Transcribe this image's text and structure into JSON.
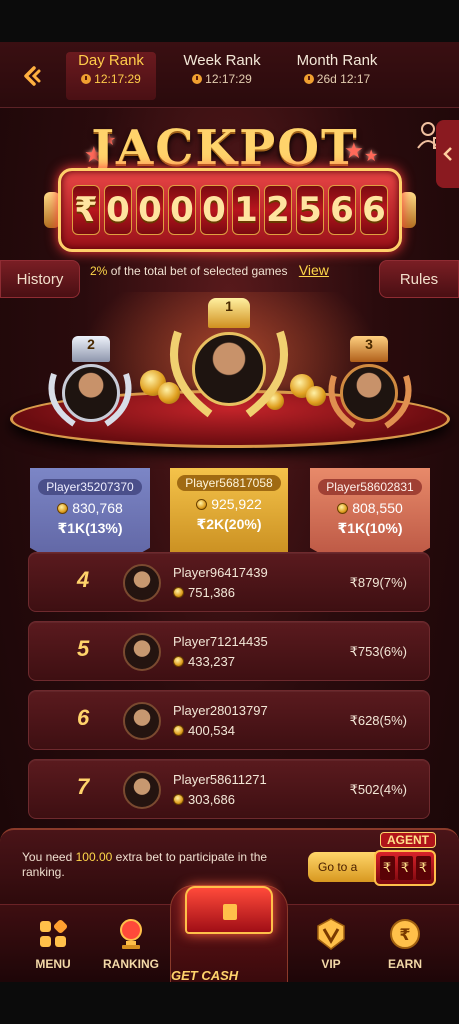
{
  "header": {
    "tabs": [
      {
        "label": "Day Rank",
        "time": "12:17:29",
        "active": true
      },
      {
        "label": "Week Rank",
        "time": "12:17:29",
        "active": false
      },
      {
        "label": "Month Rank",
        "time": "26d 12:17",
        "active": false
      }
    ]
  },
  "jackpot": {
    "title": "JACKPOT",
    "currency": "₹",
    "digits": [
      "0",
      "0",
      "0",
      "0",
      "1",
      "2",
      "5",
      "6",
      "6"
    ]
  },
  "actions": {
    "history_label": "History",
    "rules_label": "Rules",
    "info_pct": "2%",
    "info_text": "of the total bet of selected games",
    "view_label": "View"
  },
  "podium": [
    {
      "rank": "2",
      "name": "Player35207370",
      "score": "830,768",
      "reward": "₹1K(13%)"
    },
    {
      "rank": "1",
      "name": "Player56817058",
      "score": "925,922",
      "reward": "₹2K(20%)"
    },
    {
      "rank": "3",
      "name": "Player58602831",
      "score": "808,550",
      "reward": "₹1K(10%)"
    }
  ],
  "ranks": [
    {
      "rank": "4",
      "name": "Player96417439",
      "score": "751,386",
      "reward": "₹879(7%)"
    },
    {
      "rank": "5",
      "name": "Player71214435",
      "score": "433,237",
      "reward": "₹753(6%)"
    },
    {
      "rank": "6",
      "name": "Player28013797",
      "score": "400,534",
      "reward": "₹628(5%)"
    },
    {
      "rank": "7",
      "name": "Player58611271",
      "score": "303,686",
      "reward": "₹502(4%)"
    }
  ],
  "notice": {
    "prefix": "You need ",
    "amount": "100.00",
    "suffix": " extra bet to participate in the ranking.",
    "goto_label": "Go to a",
    "agent_label": "AGENT",
    "agent_glyph": "₹"
  },
  "nav": {
    "menu": "MENU",
    "ranking": "RANKING",
    "get_cash": "GET CASH",
    "vip": "VIP",
    "earn": "EARN"
  },
  "colors": {
    "accent_gold": "#ffd36b",
    "bg_maroon": "#2a0b0d",
    "jackpot_red": "#e84545"
  }
}
